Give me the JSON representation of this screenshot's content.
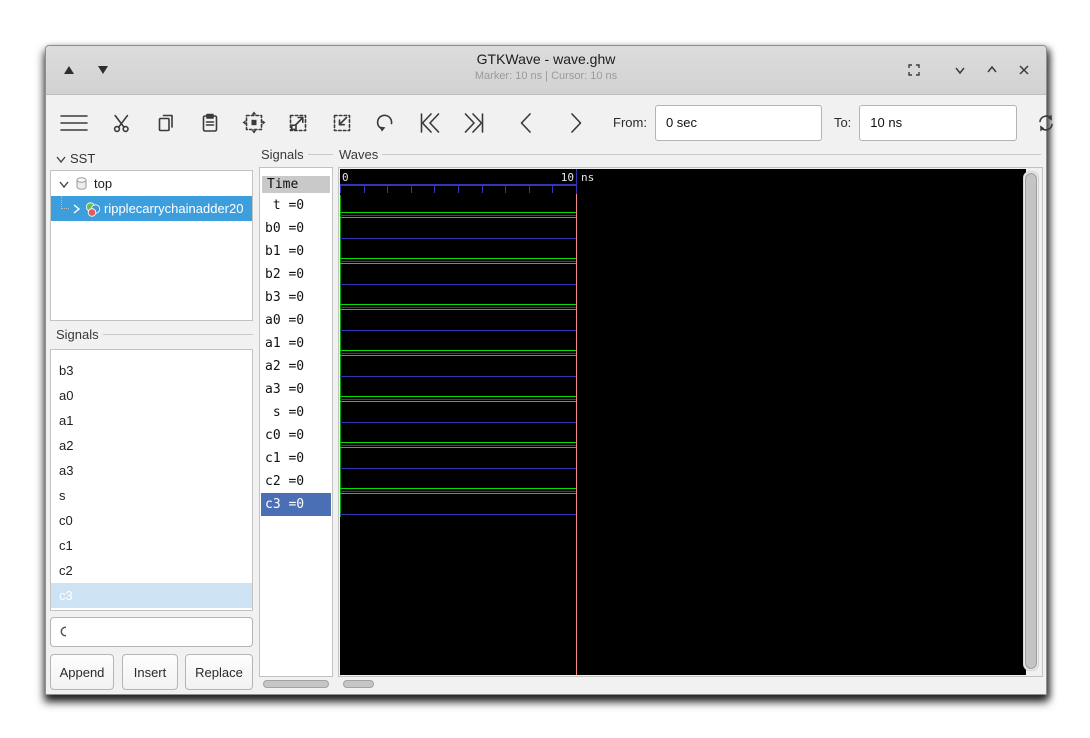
{
  "window": {
    "title": "GTKWave - wave.ghw",
    "subtitle": "Marker: 10 ns | Cursor: 10 ns",
    "controls": [
      "shade-up-triangle",
      "shade-down-triangle",
      "restore",
      "chevron-down",
      "chevron-up",
      "close"
    ]
  },
  "toolbar": {
    "icons": [
      "menu",
      "cut",
      "copy",
      "paste",
      "zoom-fit",
      "zoom-out",
      "zoom-in",
      "undo",
      "to-start",
      "to-end",
      "prev",
      "next",
      "reload"
    ],
    "from_label": "From:",
    "from_value": "0 sec",
    "to_label": "To:",
    "to_value": "10 ns"
  },
  "sst": {
    "label": "SST",
    "root": "top",
    "child": "ripplecarrychainadder20"
  },
  "left_signals": {
    "header": "Signals",
    "items": [
      "b3",
      "a0",
      "a1",
      "a2",
      "a3",
      "s",
      "c0",
      "c1",
      "c2",
      "c3"
    ],
    "selected": "c3"
  },
  "left_buttons": {
    "append": "Append",
    "insert": "Insert",
    "replace": "Replace"
  },
  "signals_panel": {
    "frame_label": "Signals",
    "time_header": "Time",
    "rows": [
      {
        "name": "t",
        "display": " t =0"
      },
      {
        "name": "b0",
        "display": "b0 =0"
      },
      {
        "name": "b1",
        "display": "b1 =0"
      },
      {
        "name": "b2",
        "display": "b2 =0"
      },
      {
        "name": "b3",
        "display": "b3 =0"
      },
      {
        "name": "a0",
        "display": "a0 =0"
      },
      {
        "name": "a1",
        "display": "a1 =0"
      },
      {
        "name": "a2",
        "display": "a2 =0"
      },
      {
        "name": "a3",
        "display": "a3 =0"
      },
      {
        "name": "s",
        "display": " s =0"
      },
      {
        "name": "c0",
        "display": "c0 =0"
      },
      {
        "name": "c1",
        "display": "c1 =0"
      },
      {
        "name": "c2",
        "display": "c2 =0"
      },
      {
        "name": "c3",
        "display": "c3 =0",
        "selected": true
      }
    ]
  },
  "waves": {
    "frame_label": "Waves",
    "timeline": {
      "start": "0",
      "end": "10",
      "unit": "ns"
    },
    "colors": {
      "background": "#000000",
      "trace_green": "#00dd00",
      "trace_green_dim": "#00a800",
      "trace_blue": "#3434b4",
      "marker": "#f58c7f",
      "selection_tree": "#3d9ede",
      "selection_row": "#4a6fb5",
      "selection_list": "#cde3f4"
    },
    "lanes": [
      {
        "name": "t",
        "style": "trio"
      },
      {
        "name": "b0",
        "style": "blue"
      },
      {
        "name": "b1",
        "style": "trio"
      },
      {
        "name": "b2",
        "style": "blue"
      },
      {
        "name": "b3",
        "style": "trio"
      },
      {
        "name": "a0",
        "style": "blue"
      },
      {
        "name": "a1",
        "style": "trio"
      },
      {
        "name": "a2",
        "style": "blue"
      },
      {
        "name": "a3",
        "style": "trio"
      },
      {
        "name": "s",
        "style": "blue"
      },
      {
        "name": "c0",
        "style": "trio"
      },
      {
        "name": "c1",
        "style": "blue"
      },
      {
        "name": "c2",
        "style": "trio"
      },
      {
        "name": "c3",
        "style": "blue"
      }
    ]
  }
}
